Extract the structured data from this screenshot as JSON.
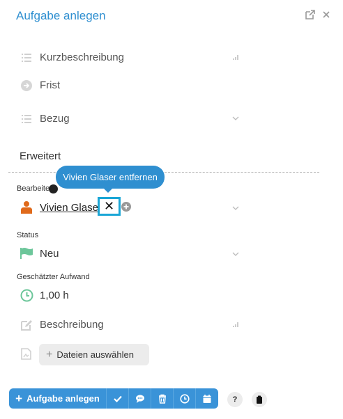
{
  "header": {
    "title": "Aufgabe anlegen"
  },
  "fields": {
    "kurzbeschreibung": "Kurzbeschreibung",
    "frist": "Frist",
    "bezug": "Bezug"
  },
  "section": {
    "title": "Erweitert"
  },
  "assignee": {
    "label": "Bearbeiter",
    "name": "Vivien Glaser",
    "tooltip": "Vivien Glaser entfernen",
    "remove_symbol": "✕"
  },
  "status": {
    "label": "Status",
    "value": "Neu"
  },
  "effort": {
    "label": "Geschätzter Aufwand",
    "value": "1,00 h"
  },
  "description": {
    "label": "Beschreibung"
  },
  "files": {
    "button_label": "Dateien auswählen"
  },
  "toolbar": {
    "create_label": "Aufgabe anlegen",
    "help_label": "?"
  },
  "colors": {
    "accent": "#2f8fd0",
    "assignee_icon": "#e06a1b",
    "status_flag": "#6cc69a",
    "effort_clock": "#6cc69a",
    "focus_border": "#1aa6d6"
  }
}
